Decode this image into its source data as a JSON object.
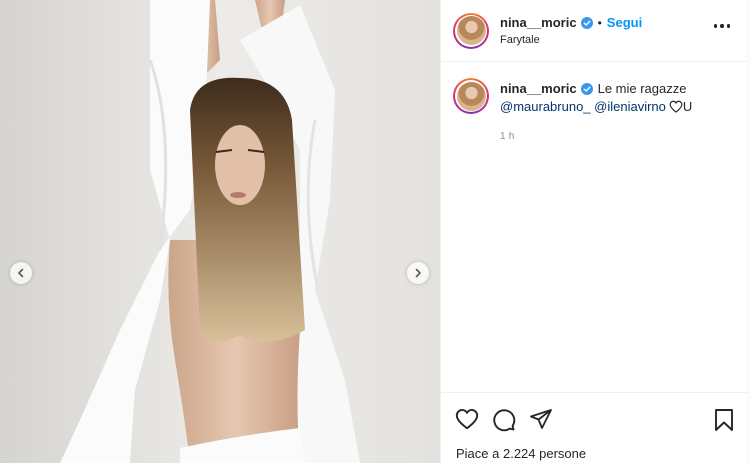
{
  "post": {
    "username": "nina__moric",
    "follow_label": "Segui",
    "separator": "•",
    "location": "Farytale",
    "caption": {
      "username": "nina__moric",
      "text": "Le mie ragazze",
      "mention1": "@maurabruno_",
      "mention2": "@ileniavirno",
      "suffix": "U",
      "time": "1 h"
    },
    "likes": "Piace a 2.224 persone"
  },
  "colors": {
    "link": "#0095f6",
    "mention": "#00376b",
    "text": "#262626",
    "muted": "#8e8e8e"
  },
  "icons": {
    "prev": "chevron-left-icon",
    "next": "chevron-right-icon",
    "more": "more-horizontal-icon",
    "like": "heart-icon",
    "comment": "comment-icon",
    "share": "paper-plane-icon",
    "save": "bookmark-icon",
    "verified": "verified-badge-icon"
  }
}
